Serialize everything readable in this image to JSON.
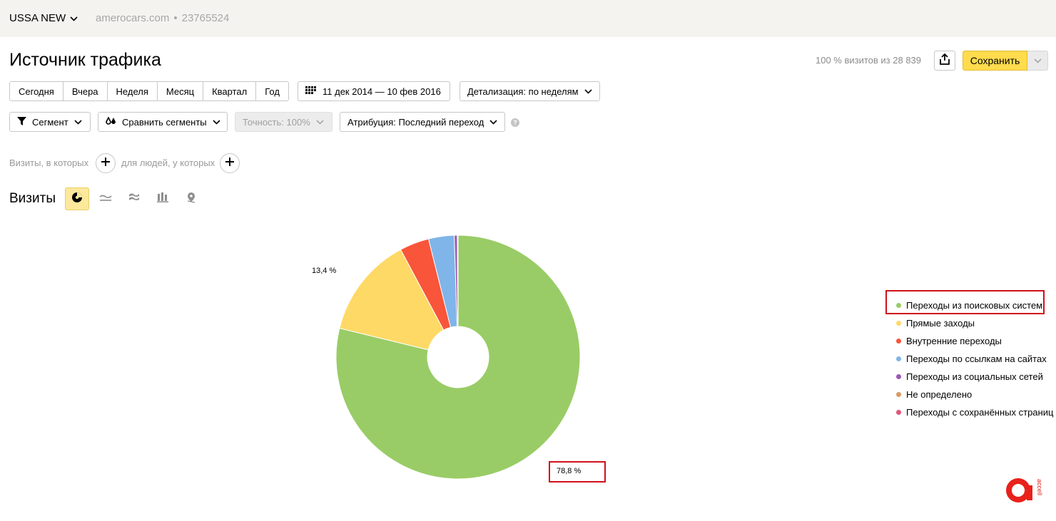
{
  "topbar": {
    "counter_name": "USSA NEW",
    "site": "amerocars.com",
    "separator": "•",
    "counter_id": "23765524"
  },
  "header": {
    "title": "Источник трафика",
    "visits_share": "100 % визитов из 28 839",
    "save_label": "Сохранить"
  },
  "period_tabs": [
    "Сегодня",
    "Вчера",
    "Неделя",
    "Месяц",
    "Квартал",
    "Год"
  ],
  "date_range": "11 дек 2014 — 10 фев 2016",
  "detail_label": "Детализация: по неделям",
  "filters": {
    "segment": "Сегмент",
    "compare": "Сравнить сегменты",
    "accuracy": "Точность: 100%",
    "attribution": "Атрибуция: Последний переход",
    "help": "?"
  },
  "conditions": {
    "visits_label": "Визиты, в которых",
    "people_label": "для людей, у которых"
  },
  "chart_heading": "Визиты",
  "view_modes": [
    "pie-chart-icon",
    "line-chart-icon",
    "area-chart-icon",
    "bar-chart-icon",
    "map-pin-icon"
  ],
  "colors": {
    "accent_yellow": "#ffdb4d",
    "highlight_red": "#d0101b"
  },
  "chart_data": {
    "type": "pie",
    "donut": true,
    "title": "",
    "labels": [
      "Переходы из поисковых систем",
      "Прямые заходы",
      "Внутренние переходы",
      "Переходы по ссылкам на сайтах",
      "Переходы из социальных сетей",
      "Не определено",
      "Переходы с сохранённых страниц"
    ],
    "values": [
      78.8,
      13.4,
      3.9,
      3.4,
      0.4,
      0.05,
      0.05
    ],
    "colors": [
      "#99cc66",
      "#ffd966",
      "#f8553a",
      "#7fb5e8",
      "#9b59b6",
      "#d99a66",
      "#e0567a"
    ],
    "data_labels": [
      "78,8 %",
      "13,4 %"
    ],
    "highlighted_label": "78,8 %",
    "highlighted_legend_item": "Переходы из поисковых систем",
    "legend_position": "right"
  }
}
